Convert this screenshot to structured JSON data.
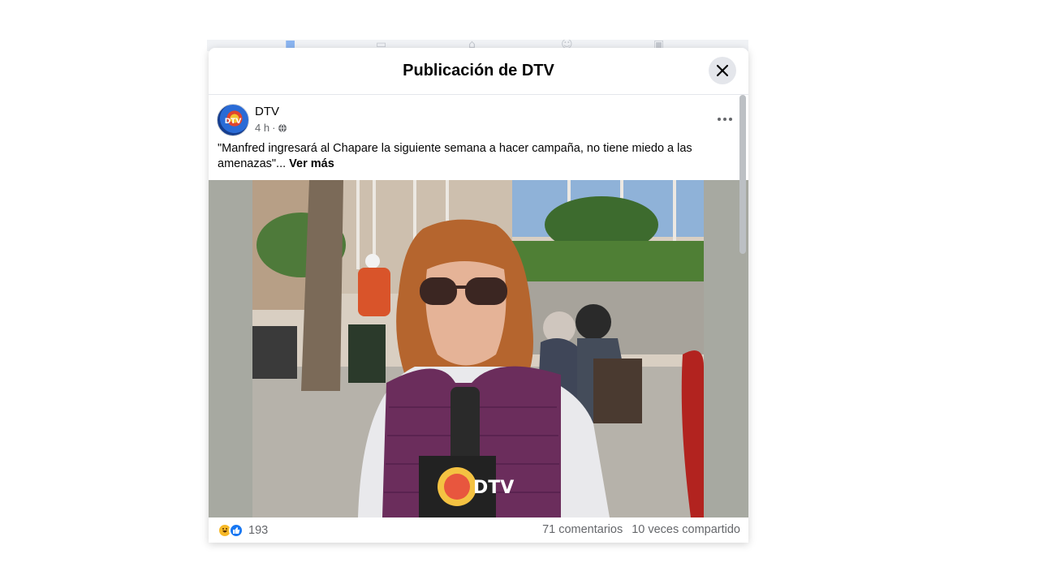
{
  "nav": {
    "icons": [
      "home-icon",
      "video-icon",
      "marketplace-icon",
      "groups-icon",
      "gaming-icon"
    ]
  },
  "modal": {
    "title": "Publicación de DTV",
    "close_icon": "close-icon"
  },
  "post": {
    "author": "DTV",
    "time": "4 h",
    "separator": "·",
    "audience_icon": "globe-icon",
    "more_icon": "more-icon",
    "text": "\"Manfred ingresará al Chapare la siguiente semana a hacer campaña, no tiene miedo a las amenazas\"...",
    "see_more": "Ver más",
    "image": {
      "logo_icon": "dtv-logo-icon",
      "mic_logo_text": "DTV"
    }
  },
  "stats": {
    "reaction_icons": [
      "haha-icon",
      "like-icon"
    ],
    "reaction_count": "193",
    "comments": "71 comentarios",
    "shares": "10 veces compartido"
  },
  "colors": {
    "accent": "#1877f2",
    "text_primary": "#050505",
    "text_secondary": "#65676b",
    "close_bg": "#e4e6eb"
  }
}
